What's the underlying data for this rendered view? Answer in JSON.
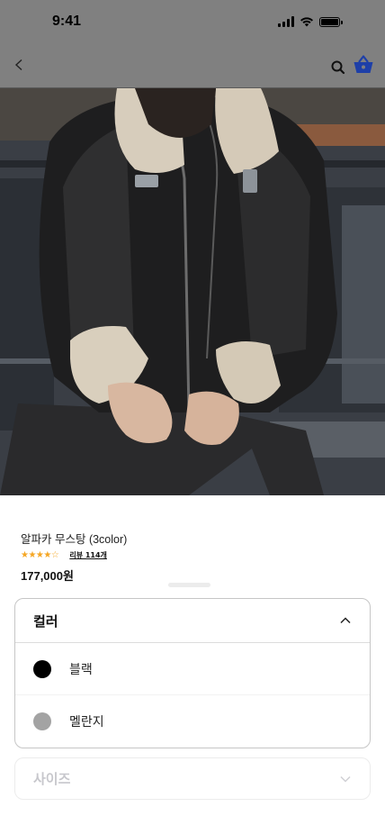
{
  "status_bar": {
    "time": "9:41",
    "signal_icon": "signal-icon",
    "wifi_icon": "wifi-icon",
    "battery_icon": "battery-icon"
  },
  "nav": {
    "back_label": "<",
    "search_icon": "search-icon",
    "cart_icon": "cart-icon",
    "accent_color": "#1e3fa8"
  },
  "product": {
    "name": "알파카 무스탕 (3color)",
    "stars": "★★★★☆",
    "review_label": "리뷰 114개",
    "price": "177,000원"
  },
  "options": {
    "color": {
      "title": "컬러",
      "expanded": true,
      "items": [
        {
          "label": "블랙",
          "swatch": "#000000"
        },
        {
          "label": "멜란지",
          "swatch": "#a3a3a3"
        }
      ]
    },
    "size": {
      "title": "사이즈",
      "expanded": false
    }
  }
}
